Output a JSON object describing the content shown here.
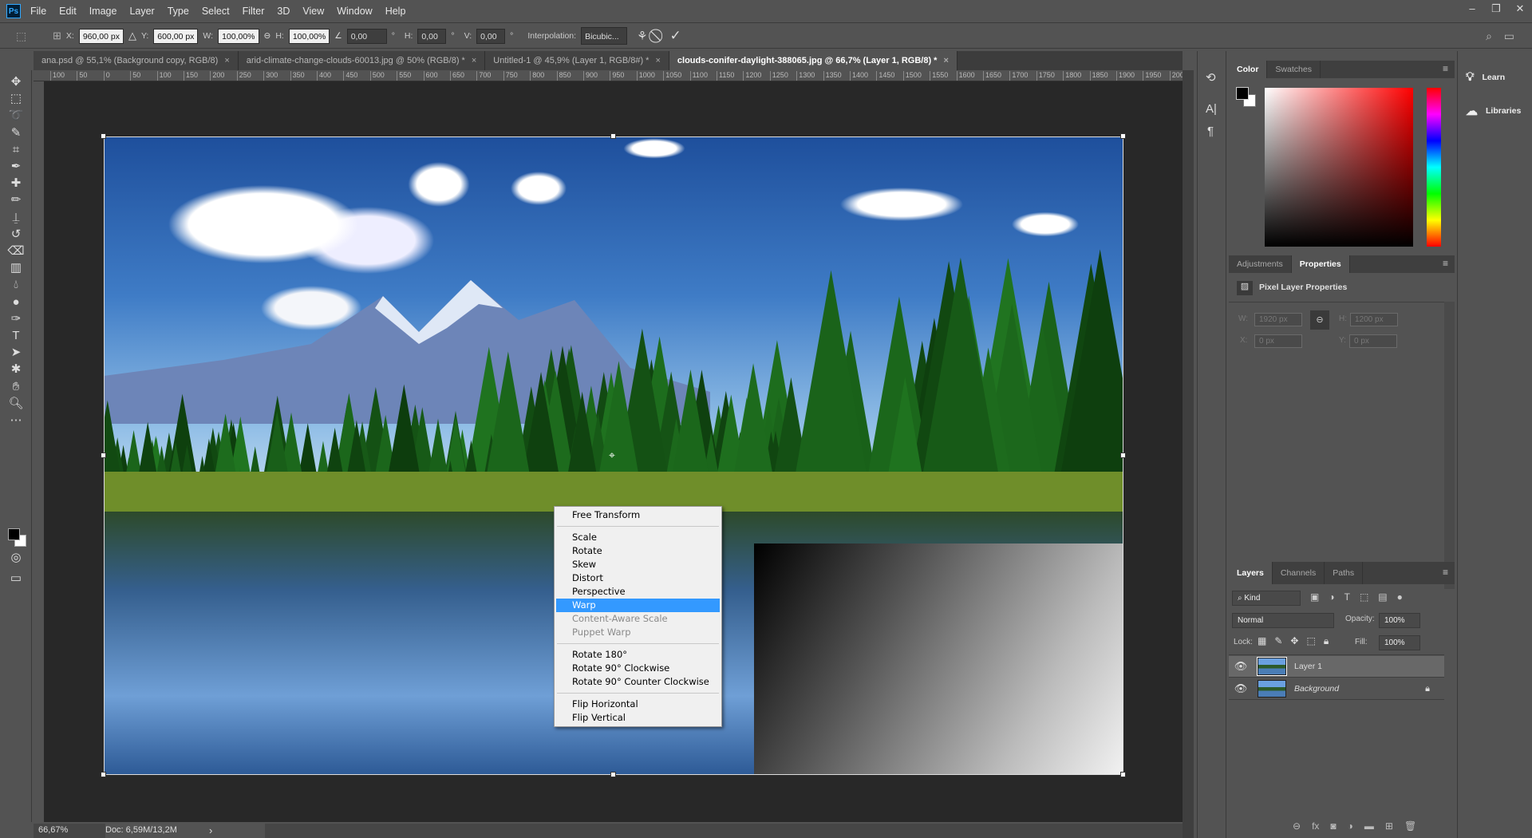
{
  "app": {
    "logo": "Ps",
    "menus": [
      "File",
      "Edit",
      "Image",
      "Layer",
      "Type",
      "Select",
      "Filter",
      "3D",
      "View",
      "Window",
      "Help"
    ],
    "window_controls": [
      "minimize",
      "restore",
      "close"
    ]
  },
  "options": {
    "x_label": "X:",
    "x": "960,00 px",
    "y_label": "Y:",
    "y": "600,00 px",
    "w_label": "W:",
    "w": "100,00%",
    "h_label": "H:",
    "h": "100,00%",
    "angle": "0,00",
    "deg": "°",
    "hskew_label": "H:",
    "hskew": "0,00",
    "vskew_label": "V:",
    "vskew": "0,00",
    "interp_label": "Interpolation:",
    "interp": "Bicubic...",
    "cancel_icon": "cancel-icon",
    "commit_icon": "checkmark-icon"
  },
  "tabs": [
    {
      "label": "ana.psd @ 55,1% (Background copy, RGB/8)",
      "close": "×"
    },
    {
      "label": "arid-climate-change-clouds-60013.jpg @ 50% (RGB/8) *",
      "close": "×"
    },
    {
      "label": "Untitled-1 @ 45,9% (Layer 1, RGB/8#) *",
      "close": "×"
    },
    {
      "label": "clouds-conifer-daylight-388065.jpg @ 66,7% (Layer 1, RGB/8) *",
      "close": "×",
      "active": true
    }
  ],
  "ruler": [
    "100",
    "50",
    "0",
    "50",
    "100",
    "150",
    "200",
    "250",
    "300",
    "350",
    "400",
    "450",
    "500",
    "550",
    "600",
    "650",
    "700",
    "750",
    "800",
    "850",
    "900",
    "950",
    "1000",
    "1050",
    "1100",
    "1150",
    "1200",
    "1250",
    "1300",
    "1350",
    "1400",
    "1450",
    "1500",
    "1550",
    "1600",
    "1650",
    "1700",
    "1750",
    "1800",
    "1850",
    "1900",
    "1950",
    "200"
  ],
  "tools": [
    "move",
    "marquee",
    "lasso",
    "quick-select",
    "crop",
    "eyedropper",
    "healing",
    "brush",
    "stamp",
    "history-brush",
    "eraser",
    "gradient",
    "blur",
    "dodge",
    "pen",
    "type",
    "path-select",
    "shape",
    "hand",
    "zoom",
    "more"
  ],
  "context_menu": {
    "groups": [
      [
        {
          "label": "Free Transform"
        }
      ],
      [
        {
          "label": "Scale"
        },
        {
          "label": "Rotate"
        },
        {
          "label": "Skew"
        },
        {
          "label": "Distort"
        },
        {
          "label": "Perspective"
        },
        {
          "label": "Warp",
          "highlighted": true
        },
        {
          "label": "Content-Aware Scale",
          "disabled": true
        },
        {
          "label": "Puppet Warp",
          "disabled": true
        }
      ],
      [
        {
          "label": "Rotate 180°"
        },
        {
          "label": "Rotate 90° Clockwise"
        },
        {
          "label": "Rotate 90° Counter Clockwise"
        }
      ],
      [
        {
          "label": "Flip Horizontal"
        },
        {
          "label": "Flip Vertical"
        }
      ]
    ]
  },
  "status": {
    "zoom": "66,67%",
    "doc": "Doc: 6,59M/13,2M",
    "arrow": "›"
  },
  "color_panel": {
    "tabs": [
      "Color",
      "Swatches"
    ],
    "active": "Color",
    "foreground": "#000000",
    "background": "#ffffff",
    "hue_color": "#ff0000"
  },
  "properties_panel": {
    "tabs": [
      "Adjustments",
      "Properties"
    ],
    "active": "Properties",
    "title": "Pixel Layer Properties",
    "w_label": "W:",
    "w": "1920 px",
    "h_label": "H:",
    "h": "1200 px",
    "x_label": "X:",
    "x": "0 px",
    "y_label": "Y:",
    "y": "0 px"
  },
  "layers_panel": {
    "tabs": [
      "Layers",
      "Channels",
      "Paths"
    ],
    "active": "Layers",
    "filter": "Kind",
    "blend_mode": "Normal",
    "opacity_label": "Opacity:",
    "opacity": "100%",
    "lock_label": "Lock:",
    "fill_label": "Fill:",
    "fill": "100%",
    "layers": [
      {
        "name": "Layer 1",
        "visible": true,
        "selected": true
      },
      {
        "name": "Background",
        "visible": true,
        "locked": true
      }
    ]
  },
  "learn_panel": {
    "items": [
      "Learn",
      "Libraries"
    ]
  }
}
